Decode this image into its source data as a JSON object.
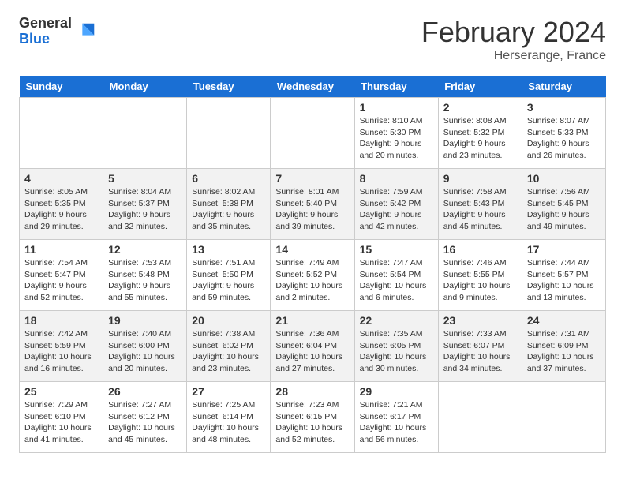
{
  "header": {
    "logo_general": "General",
    "logo_blue": "Blue",
    "month_title": "February 2024",
    "location": "Herserange, France"
  },
  "days_of_week": [
    "Sunday",
    "Monday",
    "Tuesday",
    "Wednesday",
    "Thursday",
    "Friday",
    "Saturday"
  ],
  "weeks": [
    [
      {
        "day": "",
        "info": ""
      },
      {
        "day": "",
        "info": ""
      },
      {
        "day": "",
        "info": ""
      },
      {
        "day": "",
        "info": ""
      },
      {
        "day": "1",
        "info": "Sunrise: 8:10 AM\nSunset: 5:30 PM\nDaylight: 9 hours and 20 minutes."
      },
      {
        "day": "2",
        "info": "Sunrise: 8:08 AM\nSunset: 5:32 PM\nDaylight: 9 hours and 23 minutes."
      },
      {
        "day": "3",
        "info": "Sunrise: 8:07 AM\nSunset: 5:33 PM\nDaylight: 9 hours and 26 minutes."
      }
    ],
    [
      {
        "day": "4",
        "info": "Sunrise: 8:05 AM\nSunset: 5:35 PM\nDaylight: 9 hours and 29 minutes."
      },
      {
        "day": "5",
        "info": "Sunrise: 8:04 AM\nSunset: 5:37 PM\nDaylight: 9 hours and 32 minutes."
      },
      {
        "day": "6",
        "info": "Sunrise: 8:02 AM\nSunset: 5:38 PM\nDaylight: 9 hours and 35 minutes."
      },
      {
        "day": "7",
        "info": "Sunrise: 8:01 AM\nSunset: 5:40 PM\nDaylight: 9 hours and 39 minutes."
      },
      {
        "day": "8",
        "info": "Sunrise: 7:59 AM\nSunset: 5:42 PM\nDaylight: 9 hours and 42 minutes."
      },
      {
        "day": "9",
        "info": "Sunrise: 7:58 AM\nSunset: 5:43 PM\nDaylight: 9 hours and 45 minutes."
      },
      {
        "day": "10",
        "info": "Sunrise: 7:56 AM\nSunset: 5:45 PM\nDaylight: 9 hours and 49 minutes."
      }
    ],
    [
      {
        "day": "11",
        "info": "Sunrise: 7:54 AM\nSunset: 5:47 PM\nDaylight: 9 hours and 52 minutes."
      },
      {
        "day": "12",
        "info": "Sunrise: 7:53 AM\nSunset: 5:48 PM\nDaylight: 9 hours and 55 minutes."
      },
      {
        "day": "13",
        "info": "Sunrise: 7:51 AM\nSunset: 5:50 PM\nDaylight: 9 hours and 59 minutes."
      },
      {
        "day": "14",
        "info": "Sunrise: 7:49 AM\nSunset: 5:52 PM\nDaylight: 10 hours and 2 minutes."
      },
      {
        "day": "15",
        "info": "Sunrise: 7:47 AM\nSunset: 5:54 PM\nDaylight: 10 hours and 6 minutes."
      },
      {
        "day": "16",
        "info": "Sunrise: 7:46 AM\nSunset: 5:55 PM\nDaylight: 10 hours and 9 minutes."
      },
      {
        "day": "17",
        "info": "Sunrise: 7:44 AM\nSunset: 5:57 PM\nDaylight: 10 hours and 13 minutes."
      }
    ],
    [
      {
        "day": "18",
        "info": "Sunrise: 7:42 AM\nSunset: 5:59 PM\nDaylight: 10 hours and 16 minutes."
      },
      {
        "day": "19",
        "info": "Sunrise: 7:40 AM\nSunset: 6:00 PM\nDaylight: 10 hours and 20 minutes."
      },
      {
        "day": "20",
        "info": "Sunrise: 7:38 AM\nSunset: 6:02 PM\nDaylight: 10 hours and 23 minutes."
      },
      {
        "day": "21",
        "info": "Sunrise: 7:36 AM\nSunset: 6:04 PM\nDaylight: 10 hours and 27 minutes."
      },
      {
        "day": "22",
        "info": "Sunrise: 7:35 AM\nSunset: 6:05 PM\nDaylight: 10 hours and 30 minutes."
      },
      {
        "day": "23",
        "info": "Sunrise: 7:33 AM\nSunset: 6:07 PM\nDaylight: 10 hours and 34 minutes."
      },
      {
        "day": "24",
        "info": "Sunrise: 7:31 AM\nSunset: 6:09 PM\nDaylight: 10 hours and 37 minutes."
      }
    ],
    [
      {
        "day": "25",
        "info": "Sunrise: 7:29 AM\nSunset: 6:10 PM\nDaylight: 10 hours and 41 minutes."
      },
      {
        "day": "26",
        "info": "Sunrise: 7:27 AM\nSunset: 6:12 PM\nDaylight: 10 hours and 45 minutes."
      },
      {
        "day": "27",
        "info": "Sunrise: 7:25 AM\nSunset: 6:14 PM\nDaylight: 10 hours and 48 minutes."
      },
      {
        "day": "28",
        "info": "Sunrise: 7:23 AM\nSunset: 6:15 PM\nDaylight: 10 hours and 52 minutes."
      },
      {
        "day": "29",
        "info": "Sunrise: 7:21 AM\nSunset: 6:17 PM\nDaylight: 10 hours and 56 minutes."
      },
      {
        "day": "",
        "info": ""
      },
      {
        "day": "",
        "info": ""
      }
    ]
  ]
}
